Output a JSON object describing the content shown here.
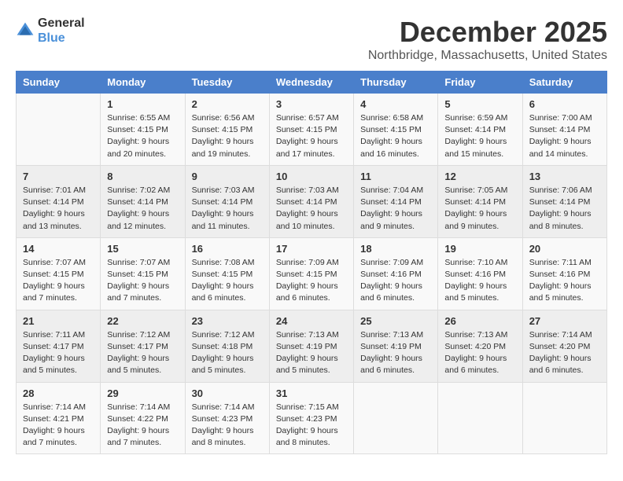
{
  "logo": {
    "general": "General",
    "blue": "Blue"
  },
  "title": {
    "month": "December 2025",
    "location": "Northbridge, Massachusetts, United States"
  },
  "headers": [
    "Sunday",
    "Monday",
    "Tuesday",
    "Wednesday",
    "Thursday",
    "Friday",
    "Saturday"
  ],
  "weeks": [
    [
      {
        "day": "",
        "sunrise": "",
        "sunset": "",
        "daylight": ""
      },
      {
        "day": "1",
        "sunrise": "Sunrise: 6:55 AM",
        "sunset": "Sunset: 4:15 PM",
        "daylight": "Daylight: 9 hours and 20 minutes."
      },
      {
        "day": "2",
        "sunrise": "Sunrise: 6:56 AM",
        "sunset": "Sunset: 4:15 PM",
        "daylight": "Daylight: 9 hours and 19 minutes."
      },
      {
        "day": "3",
        "sunrise": "Sunrise: 6:57 AM",
        "sunset": "Sunset: 4:15 PM",
        "daylight": "Daylight: 9 hours and 17 minutes."
      },
      {
        "day": "4",
        "sunrise": "Sunrise: 6:58 AM",
        "sunset": "Sunset: 4:15 PM",
        "daylight": "Daylight: 9 hours and 16 minutes."
      },
      {
        "day": "5",
        "sunrise": "Sunrise: 6:59 AM",
        "sunset": "Sunset: 4:14 PM",
        "daylight": "Daylight: 9 hours and 15 minutes."
      },
      {
        "day": "6",
        "sunrise": "Sunrise: 7:00 AM",
        "sunset": "Sunset: 4:14 PM",
        "daylight": "Daylight: 9 hours and 14 minutes."
      }
    ],
    [
      {
        "day": "7",
        "sunrise": "Sunrise: 7:01 AM",
        "sunset": "Sunset: 4:14 PM",
        "daylight": "Daylight: 9 hours and 13 minutes."
      },
      {
        "day": "8",
        "sunrise": "Sunrise: 7:02 AM",
        "sunset": "Sunset: 4:14 PM",
        "daylight": "Daylight: 9 hours and 12 minutes."
      },
      {
        "day": "9",
        "sunrise": "Sunrise: 7:03 AM",
        "sunset": "Sunset: 4:14 PM",
        "daylight": "Daylight: 9 hours and 11 minutes."
      },
      {
        "day": "10",
        "sunrise": "Sunrise: 7:03 AM",
        "sunset": "Sunset: 4:14 PM",
        "daylight": "Daylight: 9 hours and 10 minutes."
      },
      {
        "day": "11",
        "sunrise": "Sunrise: 7:04 AM",
        "sunset": "Sunset: 4:14 PM",
        "daylight": "Daylight: 9 hours and 9 minutes."
      },
      {
        "day": "12",
        "sunrise": "Sunrise: 7:05 AM",
        "sunset": "Sunset: 4:14 PM",
        "daylight": "Daylight: 9 hours and 9 minutes."
      },
      {
        "day": "13",
        "sunrise": "Sunrise: 7:06 AM",
        "sunset": "Sunset: 4:14 PM",
        "daylight": "Daylight: 9 hours and 8 minutes."
      }
    ],
    [
      {
        "day": "14",
        "sunrise": "Sunrise: 7:07 AM",
        "sunset": "Sunset: 4:15 PM",
        "daylight": "Daylight: 9 hours and 7 minutes."
      },
      {
        "day": "15",
        "sunrise": "Sunrise: 7:07 AM",
        "sunset": "Sunset: 4:15 PM",
        "daylight": "Daylight: 9 hours and 7 minutes."
      },
      {
        "day": "16",
        "sunrise": "Sunrise: 7:08 AM",
        "sunset": "Sunset: 4:15 PM",
        "daylight": "Daylight: 9 hours and 6 minutes."
      },
      {
        "day": "17",
        "sunrise": "Sunrise: 7:09 AM",
        "sunset": "Sunset: 4:15 PM",
        "daylight": "Daylight: 9 hours and 6 minutes."
      },
      {
        "day": "18",
        "sunrise": "Sunrise: 7:09 AM",
        "sunset": "Sunset: 4:16 PM",
        "daylight": "Daylight: 9 hours and 6 minutes."
      },
      {
        "day": "19",
        "sunrise": "Sunrise: 7:10 AM",
        "sunset": "Sunset: 4:16 PM",
        "daylight": "Daylight: 9 hours and 5 minutes."
      },
      {
        "day": "20",
        "sunrise": "Sunrise: 7:11 AM",
        "sunset": "Sunset: 4:16 PM",
        "daylight": "Daylight: 9 hours and 5 minutes."
      }
    ],
    [
      {
        "day": "21",
        "sunrise": "Sunrise: 7:11 AM",
        "sunset": "Sunset: 4:17 PM",
        "daylight": "Daylight: 9 hours and 5 minutes."
      },
      {
        "day": "22",
        "sunrise": "Sunrise: 7:12 AM",
        "sunset": "Sunset: 4:17 PM",
        "daylight": "Daylight: 9 hours and 5 minutes."
      },
      {
        "day": "23",
        "sunrise": "Sunrise: 7:12 AM",
        "sunset": "Sunset: 4:18 PM",
        "daylight": "Daylight: 9 hours and 5 minutes."
      },
      {
        "day": "24",
        "sunrise": "Sunrise: 7:13 AM",
        "sunset": "Sunset: 4:19 PM",
        "daylight": "Daylight: 9 hours and 5 minutes."
      },
      {
        "day": "25",
        "sunrise": "Sunrise: 7:13 AM",
        "sunset": "Sunset: 4:19 PM",
        "daylight": "Daylight: 9 hours and 6 minutes."
      },
      {
        "day": "26",
        "sunrise": "Sunrise: 7:13 AM",
        "sunset": "Sunset: 4:20 PM",
        "daylight": "Daylight: 9 hours and 6 minutes."
      },
      {
        "day": "27",
        "sunrise": "Sunrise: 7:14 AM",
        "sunset": "Sunset: 4:20 PM",
        "daylight": "Daylight: 9 hours and 6 minutes."
      }
    ],
    [
      {
        "day": "28",
        "sunrise": "Sunrise: 7:14 AM",
        "sunset": "Sunset: 4:21 PM",
        "daylight": "Daylight: 9 hours and 7 minutes."
      },
      {
        "day": "29",
        "sunrise": "Sunrise: 7:14 AM",
        "sunset": "Sunset: 4:22 PM",
        "daylight": "Daylight: 9 hours and 7 minutes."
      },
      {
        "day": "30",
        "sunrise": "Sunrise: 7:14 AM",
        "sunset": "Sunset: 4:23 PM",
        "daylight": "Daylight: 9 hours and 8 minutes."
      },
      {
        "day": "31",
        "sunrise": "Sunrise: 7:15 AM",
        "sunset": "Sunset: 4:23 PM",
        "daylight": "Daylight: 9 hours and 8 minutes."
      },
      {
        "day": "",
        "sunrise": "",
        "sunset": "",
        "daylight": ""
      },
      {
        "day": "",
        "sunrise": "",
        "sunset": "",
        "daylight": ""
      },
      {
        "day": "",
        "sunrise": "",
        "sunset": "",
        "daylight": ""
      }
    ]
  ]
}
